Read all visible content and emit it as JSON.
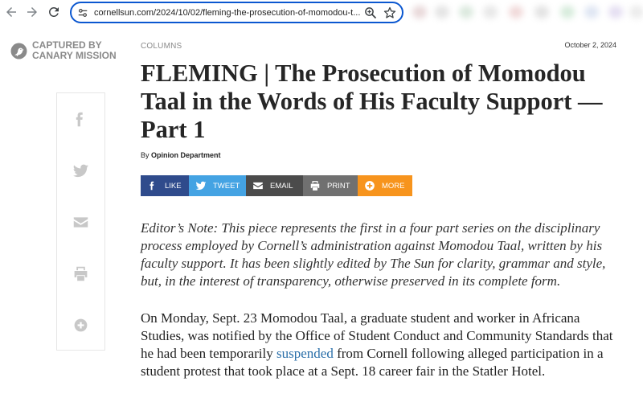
{
  "browser": {
    "back_icon": "back-arrow-icon",
    "forward_icon": "forward-arrow-icon",
    "reload_icon": "reload-icon",
    "site_settings_icon": "site-settings-icon",
    "url": "cornellsun.com/2024/10/02/fleming-the-prosecution-of-momodou-t...",
    "zoom_icon": "zoom-icon",
    "bookmark_icon": "star-icon",
    "focus_color": "#0b57d0"
  },
  "watermark": {
    "icon": "canary-mission-logo-icon",
    "line1": "CAPTURED BY",
    "line2": "CANARY MISSION",
    "color": "#8a8a8a"
  },
  "article": {
    "section": "COLUMNS",
    "date": "October 2, 2024",
    "title_lines": [
      "FLEMING | The Prosecution of Momodou",
      "Taal in the Words of His Faculty Support —",
      "Part 1"
    ],
    "byline_prefix": "By",
    "author": "Opinion Department",
    "share_buttons": [
      {
        "label": "LIKE",
        "icon": "facebook-icon",
        "color": "#2f4b8c"
      },
      {
        "label": "TWEET",
        "icon": "twitter-icon",
        "color": "#44a3e3"
      },
      {
        "label": "EMAIL",
        "icon": "email-icon",
        "color": "#4b4b4b"
      },
      {
        "label": "PRINT",
        "icon": "print-icon",
        "color": "#707070"
      },
      {
        "label": "MORE",
        "icon": "plus-circle-icon",
        "color": "#f7941d"
      }
    ],
    "editor_note_lines": [
      "Editor’s Note: This piece represents the first in a four part series on the disciplinary",
      "process employed by Cornell’s administration against Momodou Taal, written by his",
      "faculty support. It has been slightly edited by The Sun for clarity, grammar and style,",
      "but, in the interest of transparency, otherwise preserved in its complete form."
    ],
    "body_paragraph": {
      "line1": "On Monday, Sept. 23 Momodou Taal, a graduate student and worker in Africana",
      "line2": "Studies, was notified by the Office of Student Conduct and Community Standards that",
      "line3_before": "he had been temporarily ",
      "line3_link": "suspended",
      "line3_after": " from Cornell following alleged participation in a",
      "line4": "student protest that took place at a Sept. 18 career fair in the Statler Hotel."
    },
    "link_color": "#2a6fa9"
  },
  "sidebar_share": {
    "icons": [
      "facebook-icon",
      "twitter-icon",
      "email-icon",
      "print-icon",
      "plus-circle-icon"
    ],
    "icon_color": "#c8c8c8"
  }
}
